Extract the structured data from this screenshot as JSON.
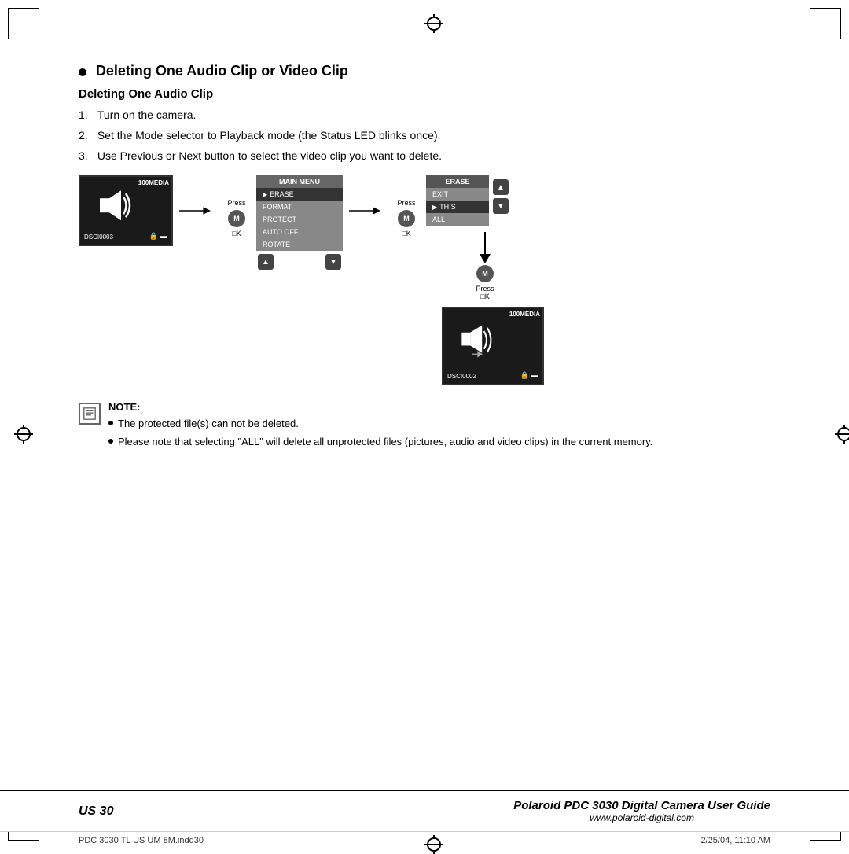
{
  "page": {
    "title": "Deleting One Audio Clip or Video Clip",
    "subsection_title": "Deleting One Audio Clip",
    "steps": [
      {
        "num": "1.",
        "text": "Turn on the camera."
      },
      {
        "num": "2.",
        "text": "Set the Mode selector to Playback mode (the Status LED blinks once)."
      },
      {
        "num": "3.",
        "text": "Use Previous or Next button to select the video clip you want to delete."
      }
    ],
    "diagram": {
      "screen1": {
        "media_label": "100MEDIA",
        "dsci_label": "DSCI0003"
      },
      "press1_label": "Press",
      "press1_ok": "□K",
      "main_menu": {
        "header": "MAIN MENU",
        "items": [
          "ERASE",
          "FORMAT",
          "PROTECT",
          "AUTO OFF",
          "ROTATE"
        ],
        "selected": 0
      },
      "press2_label": "Press",
      "press2_ok": "□K",
      "erase_menu": {
        "header": "ERASE",
        "items": [
          "EXIT",
          "THIS",
          "ALL"
        ],
        "selected": 1
      },
      "press3_label": "Press",
      "press3_ok": "□K",
      "screen2": {
        "media_label": "100MEDIA",
        "dsci_label": "DSCI0002"
      }
    },
    "note": {
      "title": "NOTE:",
      "bullets": [
        "The protected file(s) can not be deleted.",
        "Please note that selecting \"ALL\" will delete all unprotected files (pictures, audio and video clips) in the current memory."
      ]
    },
    "footer": {
      "page_label": "US 30",
      "guide_title": "Polaroid PDC 3030 Digital Camera User Guide",
      "website": "www.polaroid-digital.com",
      "file_label": "PDC 3030 TL US UM 8M.indd30",
      "date_label": "2/25/04, 11:10 AM"
    }
  }
}
